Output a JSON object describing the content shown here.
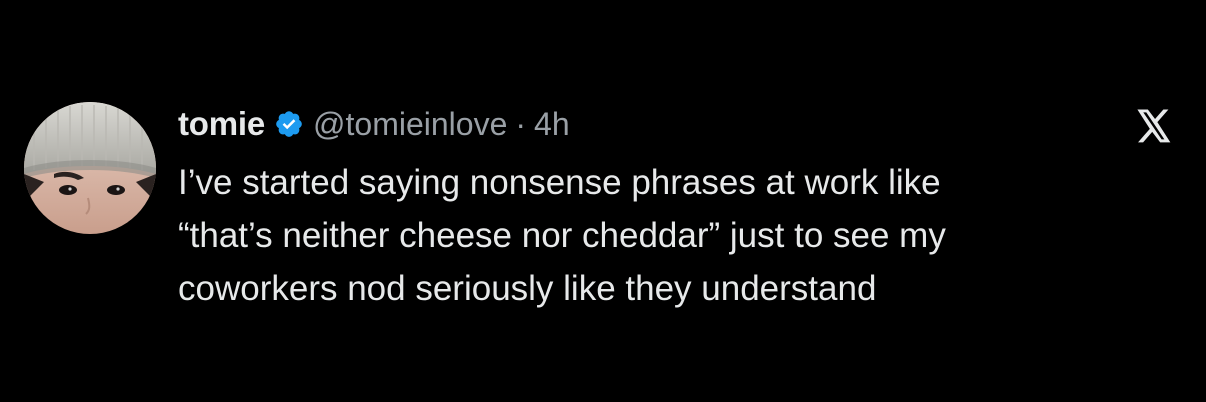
{
  "user": {
    "display_name": "tomie",
    "handle": "@tomieinlove",
    "separator": "·",
    "timestamp": "4h",
    "verified": true,
    "avatar_icon": "profile-photo-beanie"
  },
  "brand": {
    "logo_icon": "x-logo-icon",
    "verified_color": "#1d9bf0"
  },
  "tweet": {
    "lines": [
      "I’ve started saying nonsense phrases at work like",
      "“that’s neither cheese nor cheddar” just to see my",
      "coworkers nod seriously like they understand"
    ]
  },
  "colors": {
    "background": "#000000",
    "text": "#e7e9ea",
    "muted": "#9aa0a6"
  }
}
